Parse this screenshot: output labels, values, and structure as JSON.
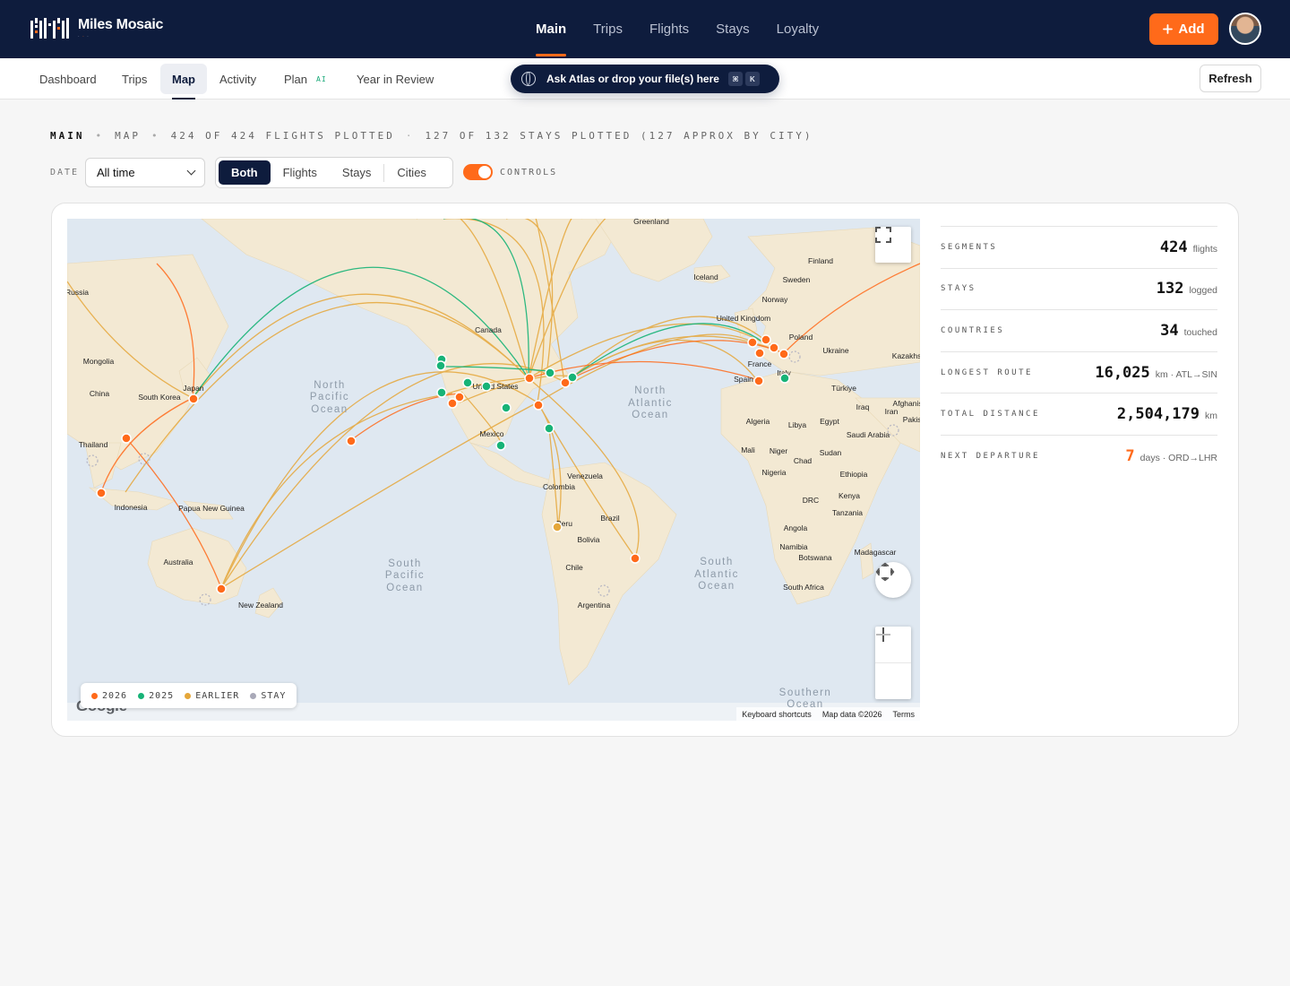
{
  "app": {
    "name": "Miles Mosaic",
    "tagline": [
      "·",
      "·",
      "·"
    ]
  },
  "mainnav": [
    {
      "label": "Main",
      "active": true
    },
    {
      "label": "Trips",
      "active": false
    },
    {
      "label": "Flights",
      "active": false
    },
    {
      "label": "Stays",
      "active": false
    },
    {
      "label": "Loyalty",
      "active": false
    }
  ],
  "header": {
    "add_label": "Add",
    "add_icon": "plus-icon"
  },
  "subnav": [
    {
      "label": "Dashboard",
      "active": false
    },
    {
      "label": "Trips",
      "active": false
    },
    {
      "label": "Map",
      "active": true
    },
    {
      "label": "Activity",
      "active": false
    },
    {
      "label": "Plan",
      "active": false,
      "badge": "AI"
    },
    {
      "label": "Year in Review",
      "active": false
    }
  ],
  "atlas": {
    "label": "Ask Atlas or drop your file(s) here",
    "keys": [
      "⌘",
      "K"
    ]
  },
  "refresh_label": "Refresh",
  "breadcrumb": {
    "root": "MAIN",
    "page": "MAP",
    "flights": "424 OF 424 FLIGHTS PLOTTED",
    "stays": "127 OF 132 STAYS PLOTTED (127 APPROX BY CITY)"
  },
  "filters": {
    "date_label": "DATE",
    "date_value": "All time",
    "modes": [
      {
        "label": "Both",
        "active": true
      },
      {
        "label": "Flights",
        "active": false
      },
      {
        "label": "Stays",
        "active": false
      },
      {
        "label": "Cities",
        "active": false
      }
    ],
    "controls_label": "CONTROLS",
    "controls_on": true
  },
  "legend": [
    {
      "label": "2026",
      "color": "#ff6a1a"
    },
    {
      "label": "2025",
      "color": "#17b377"
    },
    {
      "label": "EARLIER",
      "color": "#e5a73a"
    },
    {
      "label": "STAY",
      "color": "#a9a9b8"
    }
  ],
  "map": {
    "provider": "Google",
    "attribution": [
      "Keyboard shortcuts",
      "Map data ©2026",
      "Terms"
    ],
    "oceans": [
      {
        "name": "North Pacific Ocean",
        "lines": [
          "North",
          "Pacific",
          "Ocean"
        ]
      },
      {
        "name": "North Atlantic Ocean",
        "lines": [
          "North",
          "Atlantic",
          "Ocean"
        ]
      },
      {
        "name": "South Pacific Ocean",
        "lines": [
          "South",
          "Pacific",
          "Ocean"
        ]
      },
      {
        "name": "South Atlantic Ocean",
        "lines": [
          "South",
          "Atlantic",
          "Ocean"
        ]
      },
      {
        "name": "Southern Ocean",
        "lines": [
          "Southern",
          "Ocean"
        ]
      }
    ],
    "places": [
      "Greenland",
      "Iceland",
      "Finland",
      "Sweden",
      "Norway",
      "United Kingdom",
      "Poland",
      "Ukraine",
      "France",
      "Spain",
      "Italy",
      "Türkiye",
      "Russia",
      "Mongolia",
      "China",
      "South Korea",
      "Japan",
      "Thailand",
      "Indonesia",
      "Papua New Guinea",
      "Australia",
      "New Zealand",
      "Canada",
      "United States",
      "Mexico",
      "Venezuela",
      "Colombia",
      "Peru",
      "Brazil",
      "Bolivia",
      "Chile",
      "Argentina",
      "Algeria",
      "Libya",
      "Egypt",
      "Iraq",
      "Iran",
      "Afghanistan",
      "Saudi Arabia",
      "Mali",
      "Niger",
      "Chad",
      "Sudan",
      "Nigeria",
      "Ethiopia",
      "DRC",
      "Kenya",
      "Tanzania",
      "Angola",
      "Namibia",
      "Botswana",
      "Madagascar",
      "South Africa",
      "Kazakhstan",
      "Pakistan"
    ]
  },
  "stats": [
    {
      "label": "SEGMENTS",
      "value": "424",
      "unit": "flights",
      "accent": false
    },
    {
      "label": "STAYS",
      "value": "132",
      "unit": "logged",
      "accent": false
    },
    {
      "label": "COUNTRIES",
      "value": "34",
      "unit": "touched",
      "accent": false
    },
    {
      "label": "LONGEST ROUTE",
      "value": "16,025",
      "unit": "km · ATL→SIN",
      "accent": false
    },
    {
      "label": "TOTAL DISTANCE",
      "value": "2,504,179",
      "unit": "km",
      "accent": false
    },
    {
      "label": "NEXT DEPARTURE",
      "value": "7",
      "unit": "days · ORD→LHR",
      "accent": true
    }
  ]
}
